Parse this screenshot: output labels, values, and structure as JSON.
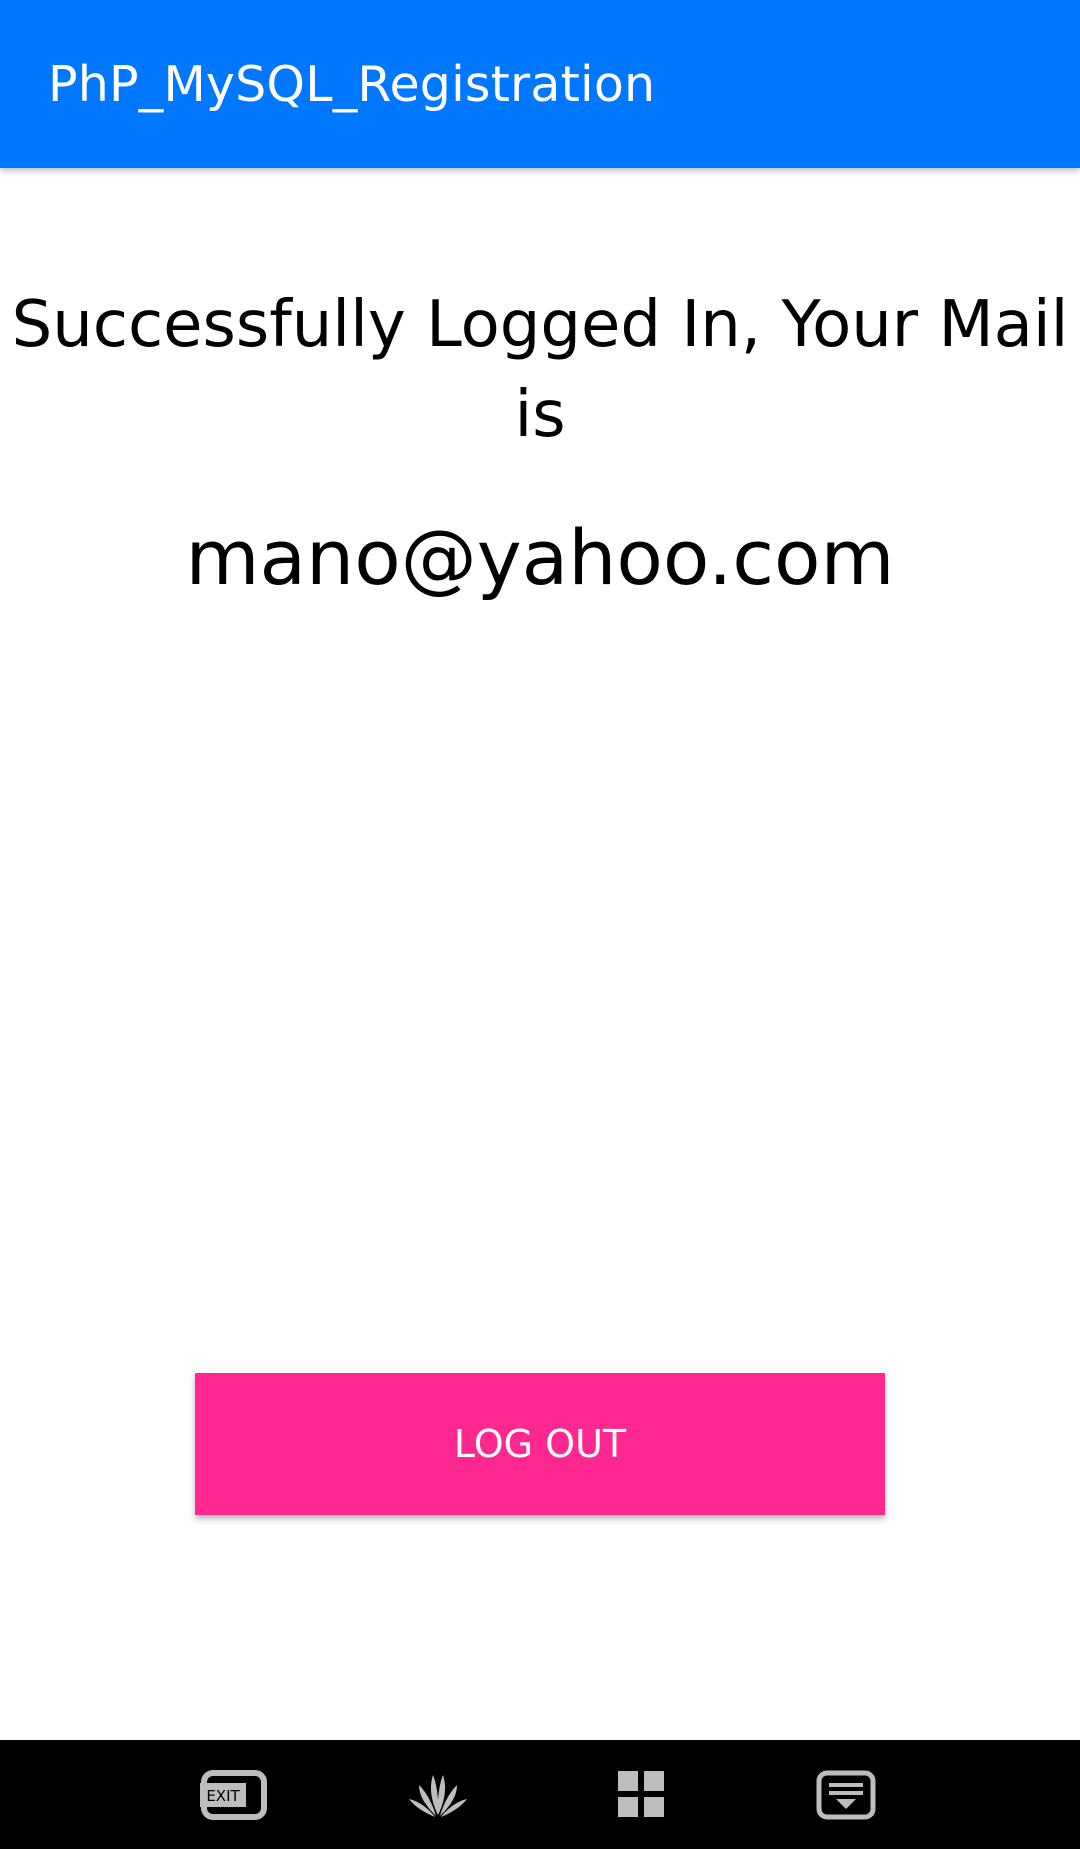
{
  "colors": {
    "appbar": "#0077FF",
    "accent_button": "#FF2890",
    "nav_icon": "#BDBDBD"
  },
  "appbar": {
    "title": "PhP_MySQL_Registration"
  },
  "main": {
    "message": "Successfully Logged In, Your Mail is",
    "email": "mano@yahoo.com",
    "logout_label": "LOG OUT"
  },
  "navbar": {
    "exit_label": "EXIT",
    "icons": [
      "exit-icon",
      "huawei-logo-icon",
      "grid-icon",
      "keyboard-hide-icon"
    ]
  }
}
